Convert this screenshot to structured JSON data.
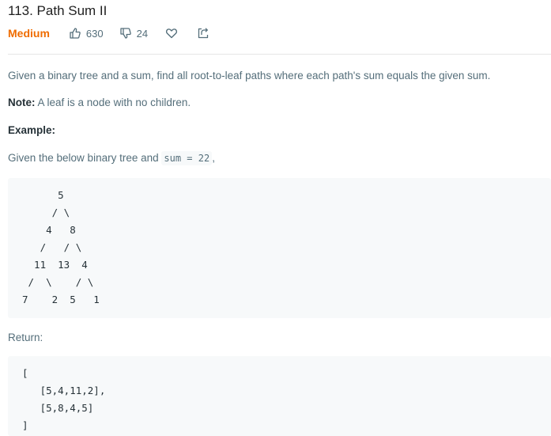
{
  "problem": {
    "title": "113. Path Sum II",
    "difficulty": "Medium",
    "likes": "630",
    "dislikes": "24"
  },
  "icons": {
    "likes": "thumbs-up-icon",
    "dislikes": "thumbs-down-icon",
    "favorite": "heart-icon",
    "share": "share-icon"
  },
  "colors": {
    "difficulty": "#ef6c00",
    "text": "#546e7a",
    "code_background": "#f7f9fa"
  },
  "description": {
    "text": "Given a binary tree and a sum, find all root-to-leaf paths where each path's sum equals the given sum.",
    "note_label": "Note:",
    "note_text": "A leaf is a node with no children.",
    "example_label": "Example:",
    "given_text": "Given the below binary tree and",
    "given_code": "sum = 22",
    "given_suffix": ","
  },
  "tree_lines": [
    "      5",
    "     / \\",
    "    4   8",
    "   /   / \\",
    "  11  13  4",
    " /  \\    / \\",
    "7    2  5   1"
  ],
  "return_label": "Return:",
  "return_lines": [
    "[",
    "   [5,4,11,2],",
    "   [5,8,4,5]",
    "]"
  ]
}
